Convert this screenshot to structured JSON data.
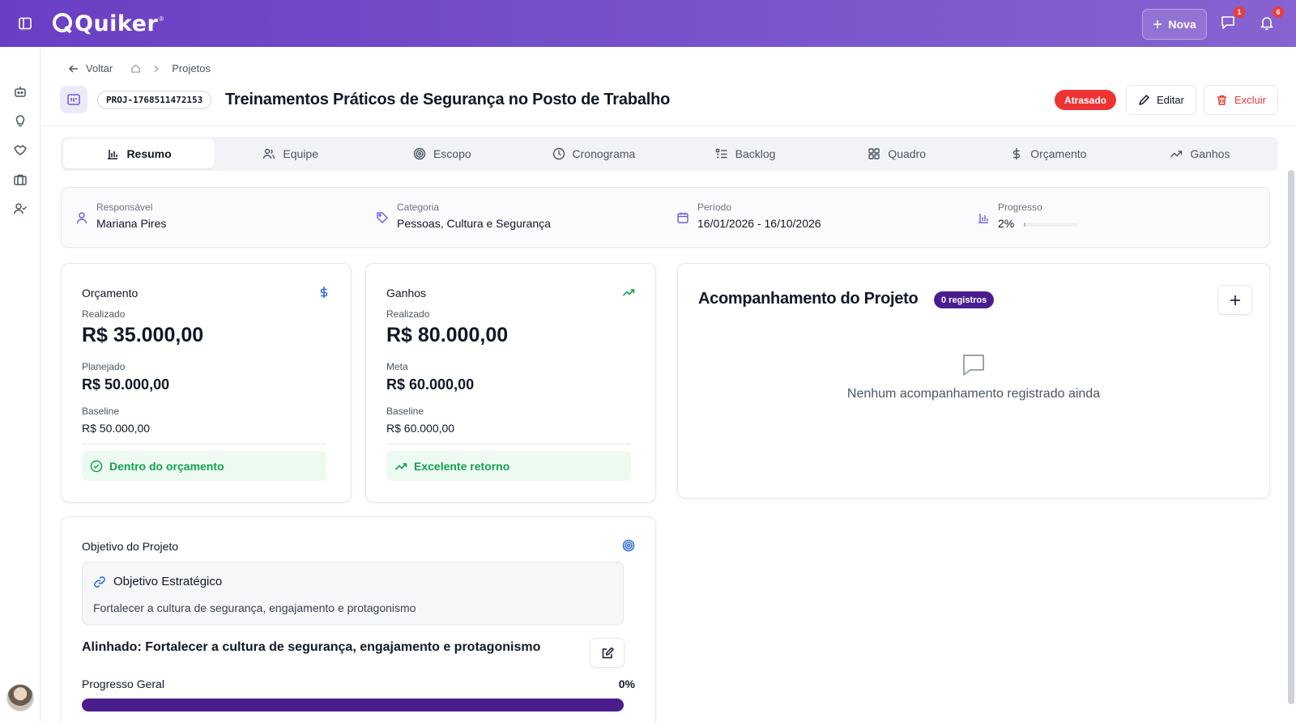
{
  "topbar": {
    "logo_text": "Quiker",
    "logo_reg": "®",
    "new_button_label": "Nova",
    "messages_badge": "1",
    "notifications_badge": "6"
  },
  "breadcrumb": {
    "back_label": "Voltar",
    "current": "Projetos"
  },
  "project": {
    "code": "PROJ-1768511472153",
    "title": "Treinamentos Práticos de Segurança no Posto de Trabalho",
    "status": "Atrasado",
    "edit_label": "Editar",
    "delete_label": "Excluir"
  },
  "tabs": [
    {
      "label": "Resumo",
      "icon": "bar-chart-icon"
    },
    {
      "label": "Equipe",
      "icon": "users-icon"
    },
    {
      "label": "Escopo",
      "icon": "target-icon"
    },
    {
      "label": "Cronograma",
      "icon": "clock-icon"
    },
    {
      "label": "Backlog",
      "icon": "list-icon"
    },
    {
      "label": "Quadro",
      "icon": "grid-icon"
    },
    {
      "label": "Orçamento",
      "icon": "dollar-icon"
    },
    {
      "label": "Ganhos",
      "icon": "trending-up-icon"
    }
  ],
  "info": {
    "responsible_label": "Responsável",
    "responsible_value": "Mariana Pires",
    "category_label": "Categoria",
    "category_value": "Pessoas, Cultura e Segurança",
    "period_label": "Período",
    "period_value": "16/01/2026 - 16/10/2026",
    "progress_label": "Progresso",
    "progress_value": "2%",
    "progress_fraction": 0.02
  },
  "budget": {
    "title": "Orçamento",
    "realized_label": "Realizado",
    "realized_value": "R$ 35.000,00",
    "planned_label": "Planejado",
    "planned_value": "R$ 50.000,00",
    "baseline_label": "Baseline",
    "baseline_value": "R$ 50.000,00",
    "status": "Dentro do orçamento"
  },
  "gains": {
    "title": "Ganhos",
    "realized_label": "Realizado",
    "realized_value": "R$ 80.000,00",
    "goal_label": "Meta",
    "goal_value": "R$ 60.000,00",
    "baseline_label": "Baseline",
    "baseline_value": "R$ 60.000,00",
    "status": "Excelente retorno"
  },
  "tracking": {
    "title": "Acompanhamento do Projeto",
    "badge": "0 registros",
    "empty_text": "Nenhum acompanhamento registrado ainda"
  },
  "objective": {
    "title": "Objetivo do Projeto",
    "strategic_label": "Objetivo Estratégico",
    "strategic_text": "Fortalecer a cultura de segurança, engajamento e protagonismo",
    "aligned_text": "Alinhado: Fortalecer a cultura de segurança, engajamento e protagonismo",
    "progress_label": "Progresso Geral",
    "progress_value": "0%"
  },
  "colors": {
    "brand": "#6a3fc4",
    "accent_dark": "#4a1d8f",
    "danger": "#ef3333",
    "success": "#15a050"
  }
}
